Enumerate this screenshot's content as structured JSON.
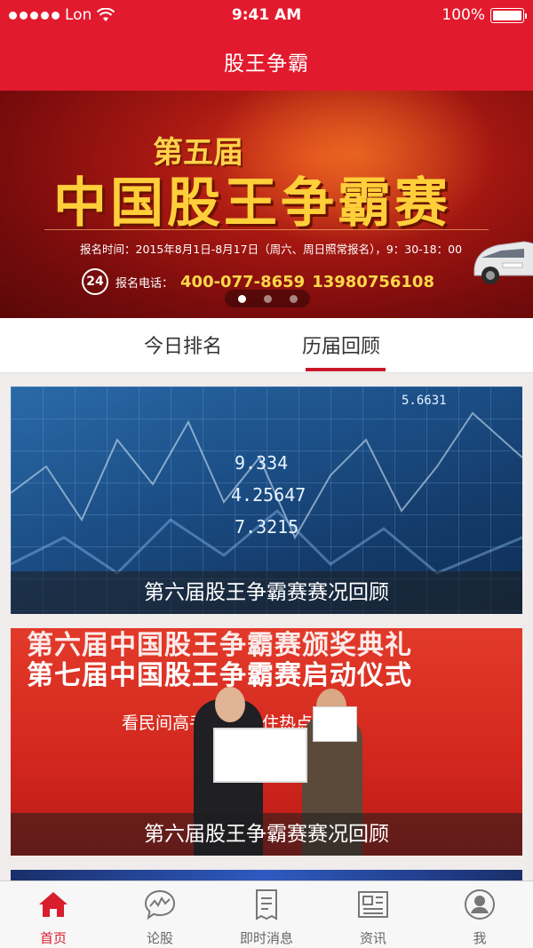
{
  "status_bar": {
    "carrier": "Lon",
    "time": "9:41 AM",
    "battery": "100%"
  },
  "nav": {
    "title": "股王争霸"
  },
  "banner": {
    "subtitle": "第五届",
    "headline": "中国股王争霸赛",
    "schedule": "报名时间：2015年8月1日-8月17日（周六、周日照常报名），9：30-18：00",
    "badge": "24",
    "phone_label": "报名电话：",
    "phone1": "400-077-8659",
    "phone2": "13980756108",
    "pages": 3,
    "active_page": 0
  },
  "tabs": [
    {
      "label": "今日排名"
    },
    {
      "label": "历届回顾",
      "active": true
    }
  ],
  "cards": [
    {
      "caption": "第六届股王争霸赛赛况回顾",
      "numbers": [
        "9.334",
        "4.25647",
        "7.3215",
        "5.6631"
      ]
    },
    {
      "caption": "第六届股王争霸赛赛况回顾",
      "line1": "第六届中国股王争霸赛颁奖典礼",
      "line2": "第七届中国股王争霸赛启动仪式",
      "slogan": "看民间高手控制 ，住热点！"
    }
  ],
  "tabbar": [
    {
      "label": "首页",
      "icon": "home-icon",
      "active": true
    },
    {
      "label": "论股",
      "icon": "chat-chart-icon"
    },
    {
      "label": "即时消息",
      "icon": "document-icon"
    },
    {
      "label": "资讯",
      "icon": "newspaper-icon"
    },
    {
      "label": "我",
      "icon": "user-icon"
    }
  ],
  "colors": {
    "brand_red": "#e21a2d",
    "tab_active": "#d81e2c",
    "tab_underline": "#c8182a"
  }
}
